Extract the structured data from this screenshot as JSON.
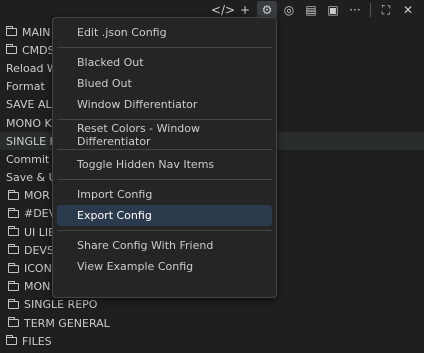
{
  "toolbar": {
    "items": [
      {
        "name": "code-icon",
        "glyph": "</>"
      },
      {
        "name": "plus-icon",
        "glyph": "+"
      },
      {
        "name": "gear-icon",
        "glyph": "⚙"
      },
      {
        "name": "copilot-icon",
        "glyph": "◎"
      },
      {
        "name": "layout-icon",
        "glyph": "▤"
      },
      {
        "name": "panel-icon",
        "glyph": "▣"
      },
      {
        "name": "more-icon",
        "glyph": "···"
      },
      {
        "name": "maximize-icon",
        "glyph": "⛶"
      },
      {
        "name": "close-icon",
        "glyph": "✕"
      }
    ]
  },
  "tree": {
    "rows": [
      {
        "type": "folder",
        "label": "MAIN"
      },
      {
        "type": "folder",
        "label": "CMDS"
      },
      {
        "type": "item",
        "label": "Reload W"
      },
      {
        "type": "item",
        "label": "Format"
      },
      {
        "type": "item",
        "label": "SAVE ALL"
      },
      {
        "type": "item",
        "label": "MONO K"
      },
      {
        "type": "item",
        "label": "SINGLE K"
      },
      {
        "type": "item",
        "label": "Commit A"
      },
      {
        "type": "item",
        "label": "Save & U"
      },
      {
        "type": "subfolder",
        "label": "MOR"
      },
      {
        "type": "subfolder",
        "label": "#DEV"
      },
      {
        "type": "subfolder",
        "label": "UI LIB"
      },
      {
        "type": "subfolder",
        "label": "DEVS"
      },
      {
        "type": "subfolder",
        "label": "ICON"
      },
      {
        "type": "subfolder",
        "label": "MON"
      },
      {
        "type": "subfolder",
        "label": "SINGLE REPO"
      },
      {
        "type": "subfolder",
        "label": "TERM GENERAL"
      },
      {
        "type": "folder",
        "label": "FILES"
      }
    ]
  },
  "menu": {
    "groups": [
      [
        "Edit .json Config"
      ],
      [
        "Blacked Out",
        "Blued Out",
        "Window Differentiator"
      ],
      [
        "Reset Colors - Window Differentiator"
      ],
      [
        "Toggle Hidden Nav Items"
      ],
      [
        "Import Config",
        "Export Config"
      ],
      [
        "Share Config With Friend",
        "View Example Config"
      ]
    ],
    "selected": "Export Config"
  }
}
